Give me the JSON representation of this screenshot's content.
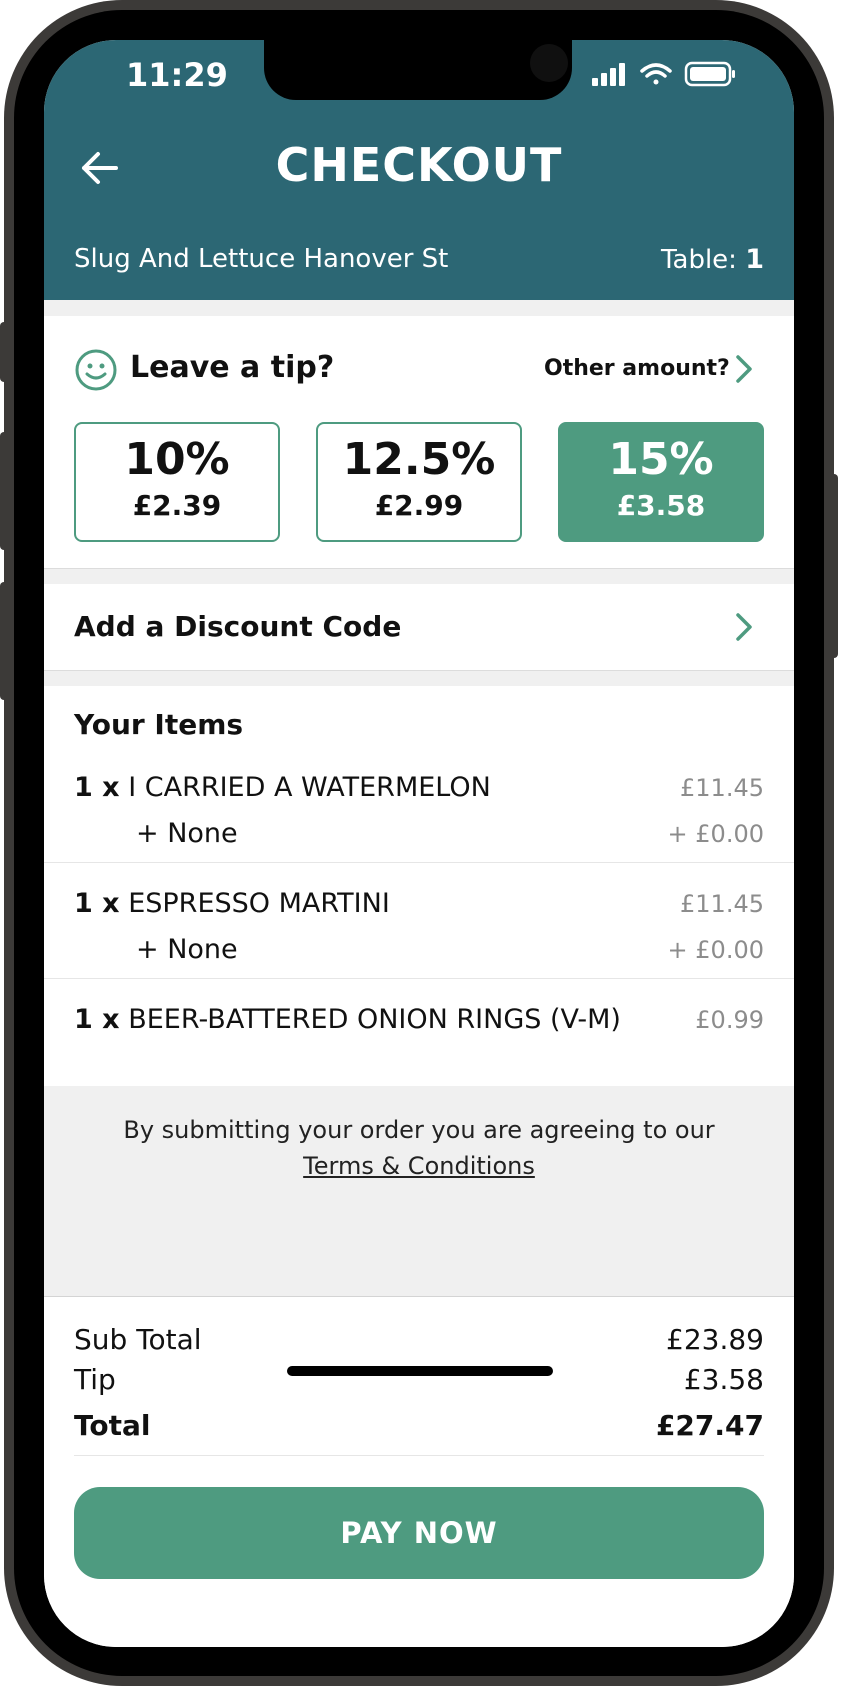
{
  "status_bar": {
    "time": "11:29"
  },
  "header": {
    "title": "CHECKOUT",
    "venue": "Slug And Lettuce Hanover St",
    "table_label": "Table:",
    "table_number": "1"
  },
  "tip": {
    "title": "Leave a tip?",
    "other_label": "Other amount?",
    "options": [
      {
        "percent": "10%",
        "amount": "£2.39",
        "selected": false
      },
      {
        "percent": "12.5%",
        "amount": "£2.99",
        "selected": false
      },
      {
        "percent": "15%",
        "amount": "£3.58",
        "selected": true
      }
    ]
  },
  "discount": {
    "label": "Add a Discount Code"
  },
  "items": {
    "title": "Your Items",
    "list": [
      {
        "qty": "1 x",
        "name": "I CARRIED A WATERMELON",
        "price": "£11.45",
        "modifier": "+ None",
        "modifier_price": "+ £0.00"
      },
      {
        "qty": "1 x",
        "name": "ESPRESSO MARTINI",
        "price": "£11.45",
        "modifier": "+ None",
        "modifier_price": "+ £0.00"
      },
      {
        "qty": "1 x",
        "name": "BEER-BATTERED ONION RINGS (V-M)",
        "price": "£0.99"
      }
    ]
  },
  "terms": {
    "text": "By submitting your order you are agreeing to our",
    "link": "Terms & Conditions"
  },
  "totals": {
    "subtotal_label": "Sub Total",
    "subtotal_value": "£23.89",
    "tip_label": "Tip",
    "tip_value": "£3.58",
    "total_label": "Total",
    "total_value": "£27.47"
  },
  "pay_button": "PAY NOW",
  "colors": {
    "header": "#2c6774",
    "accent": "#4e9b80",
    "background_gray": "#f0f0f0"
  }
}
